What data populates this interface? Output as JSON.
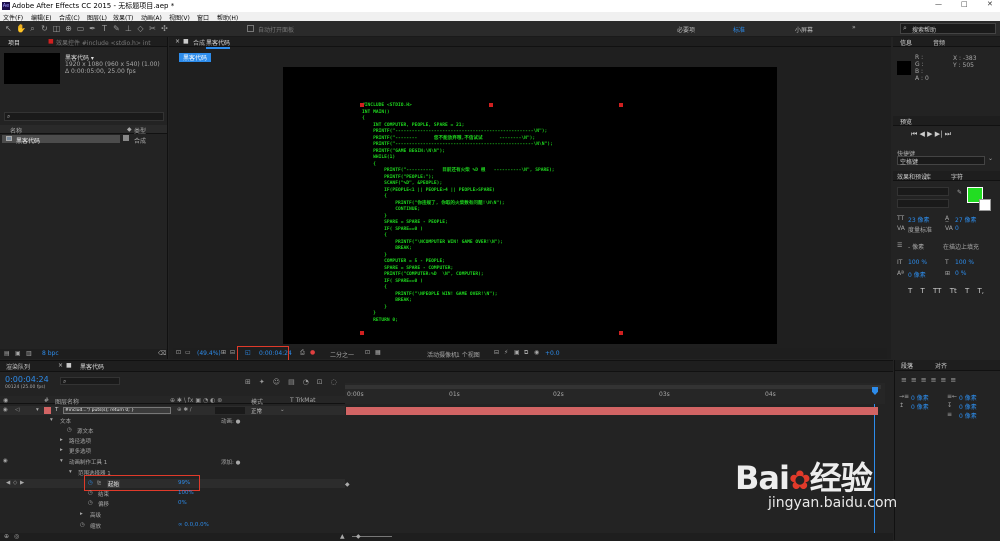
{
  "window": {
    "title": "Adobe After Effects CC 2015 - 无标题项目.aep *",
    "logo": "Ae"
  },
  "menu": [
    "文件(F)",
    "编辑(E)",
    "合成(C)",
    "图层(L)",
    "效果(T)",
    "动画(A)",
    "视图(V)",
    "窗口",
    "帮助(H)"
  ],
  "toolbar": {
    "auto_open": "自动打开面板",
    "workspaces": [
      "必要项",
      "标准",
      "小屏幕"
    ],
    "workspace_more": "»",
    "search": "搜索帮助"
  },
  "project": {
    "tab": "项目",
    "effects_tab": "效果控件 #include <stdio.h> int",
    "comp_name": "黑客代码 ▾",
    "comp_info1": "1920 x 1080 (960 x 540) (1.00)",
    "comp_info2": "Δ 0:00:05:00, 25.00 fps",
    "col_name": "名称",
    "col_type": "类型",
    "item_name": "黑客代码",
    "item_type": "合成",
    "bpc": "8 bpc"
  },
  "comp": {
    "tab_prefix": "合成",
    "tab_name": "黑客代码",
    "breadcrumb": "黑客代码",
    "zoom": "(49.4%)",
    "timecode": "0:00:04:24",
    "resolution": "二分之一",
    "camera": "活动摄像机",
    "views": "1 个视图",
    "exposure": "+0.0",
    "code_lines": [
      "#INCLUDE <STDIO.H>",
      "INT MAIN()",
      "{",
      "    INT COMPUTER, PEOPLE, SPARE = 21;",
      "    PRINTF(\"--------------------------------------------------\\N\");",
      "    PRINTF(\"--------      您不能放弃哦,不信试试      --------\\N\");",
      "    PRINTF(\"--------------------------------------------------\\N\\N\");",
      "    PRINTF(\"GAME BEGIN:\\N\\N\");",
      "    WHILE(1)",
      "    {",
      "        PRINTF(\"----------   目前还有火柴 %D 根   ----------\\N\", SPARE);",
      "        PRINTF(\"PEOPLE:\");",
      "        SCANF(\"%D\", &PEOPLE);",
      "        IF(PEOPLE<1 || PEOPLE>4 || PEOPLE>SPARE)",
      "        {",
      "            PRINTF(\"你违规了, 你取的火柴数有问题!\\N\\N\");",
      "            CONTINUE;",
      "        }",
      "        SPARE = SPARE - PEOPLE;",
      "        IF( SPARE==0 )",
      "        {",
      "            PRINTF(\"\\NCOMPUTER WIN! GAME OVER!\\N\");",
      "            BREAK;",
      "        }",
      "        COMPUTER = 5 - PEOPLE;",
      "        SPARE = SPARE - COMPUTER;",
      "        PRINTF(\"COMPUTER:%D  \\N\", COMPUTER);",
      "        IF( SPARE==0 )",
      "        {",
      "            PRINTF(\"\\NPEOPLE WIN! GAME OVER!\\N\");",
      "            BREAK;",
      "        }",
      "    }",
      "    RETURN 0;"
    ]
  },
  "info": {
    "tab": "信息",
    "audio_tab": "音频",
    "r": "R :",
    "g": "G :",
    "b": "B :",
    "a": "A : 0",
    "x": "X : -383",
    "y": "Y : 505"
  },
  "preview": {
    "tab": "预览",
    "shortcut_label": "快捷键",
    "shortcut_value": "空格键"
  },
  "character": {
    "tab1": "效果和预设",
    "tab2": "库",
    "tab3": "字符",
    "size": "23 像素",
    "leading": "27 像素",
    "kerning": "度量标准",
    "tracking": "0",
    "stroke": "- 像素",
    "stroke_mode": "在描边上填充",
    "vscale": "100 %",
    "hscale": "100 %",
    "baseline": "0 像素",
    "tsume": "0 %",
    "styles": [
      "T",
      "T",
      "TT",
      "Tt",
      "T",
      "T,",
      "T"
    ]
  },
  "paragraph": {
    "tab1": "段落",
    "tab2": "对齐",
    "v1": "0 像素",
    "v2": "0 像素",
    "v3": "0 像素",
    "v4": "0 像素",
    "v5": "0 像素"
  },
  "timeline": {
    "tab1": "渲染队列",
    "tab2": "黑客代码",
    "timecode": "0:00:04:24",
    "frames": "00124 (25.00 fps)",
    "col_layer": "图层名称",
    "col_mode": "模式",
    "col_trkmat": "T  TrkMat",
    "ruler": [
      "0:00s",
      "01s",
      "02s",
      "03s",
      "04s"
    ],
    "rows": [
      {
        "name": "#includ...\"/    puts(s);    return 0; }",
        "mode": "正常"
      },
      {
        "name": "文本",
        "extra": "动画: ●"
      },
      {
        "name": "源文本"
      },
      {
        "name": "路径选项"
      },
      {
        "name": "更多选项"
      },
      {
        "name": "动画制作工具 1",
        "extra": "添加: ●"
      },
      {
        "name": "范围选择器 1"
      },
      {
        "name": "起始",
        "value": "99%"
      },
      {
        "name": "结束",
        "value": "100%"
      },
      {
        "name": "偏移",
        "value": "0%"
      },
      {
        "name": "高级"
      },
      {
        "name": "缩放",
        "value": "∞ 0.0,0.0%"
      }
    ]
  },
  "watermark": {
    "brand": "Bai",
    "brand2": "经验",
    "url": "jingyan.baidu.com"
  },
  "colors": {
    "accent": "#2d8ceb",
    "code_green": "#1ed61e",
    "highlight": "#e03a2a",
    "layer_bar": "#d26464",
    "swatch": "#22dd22"
  }
}
